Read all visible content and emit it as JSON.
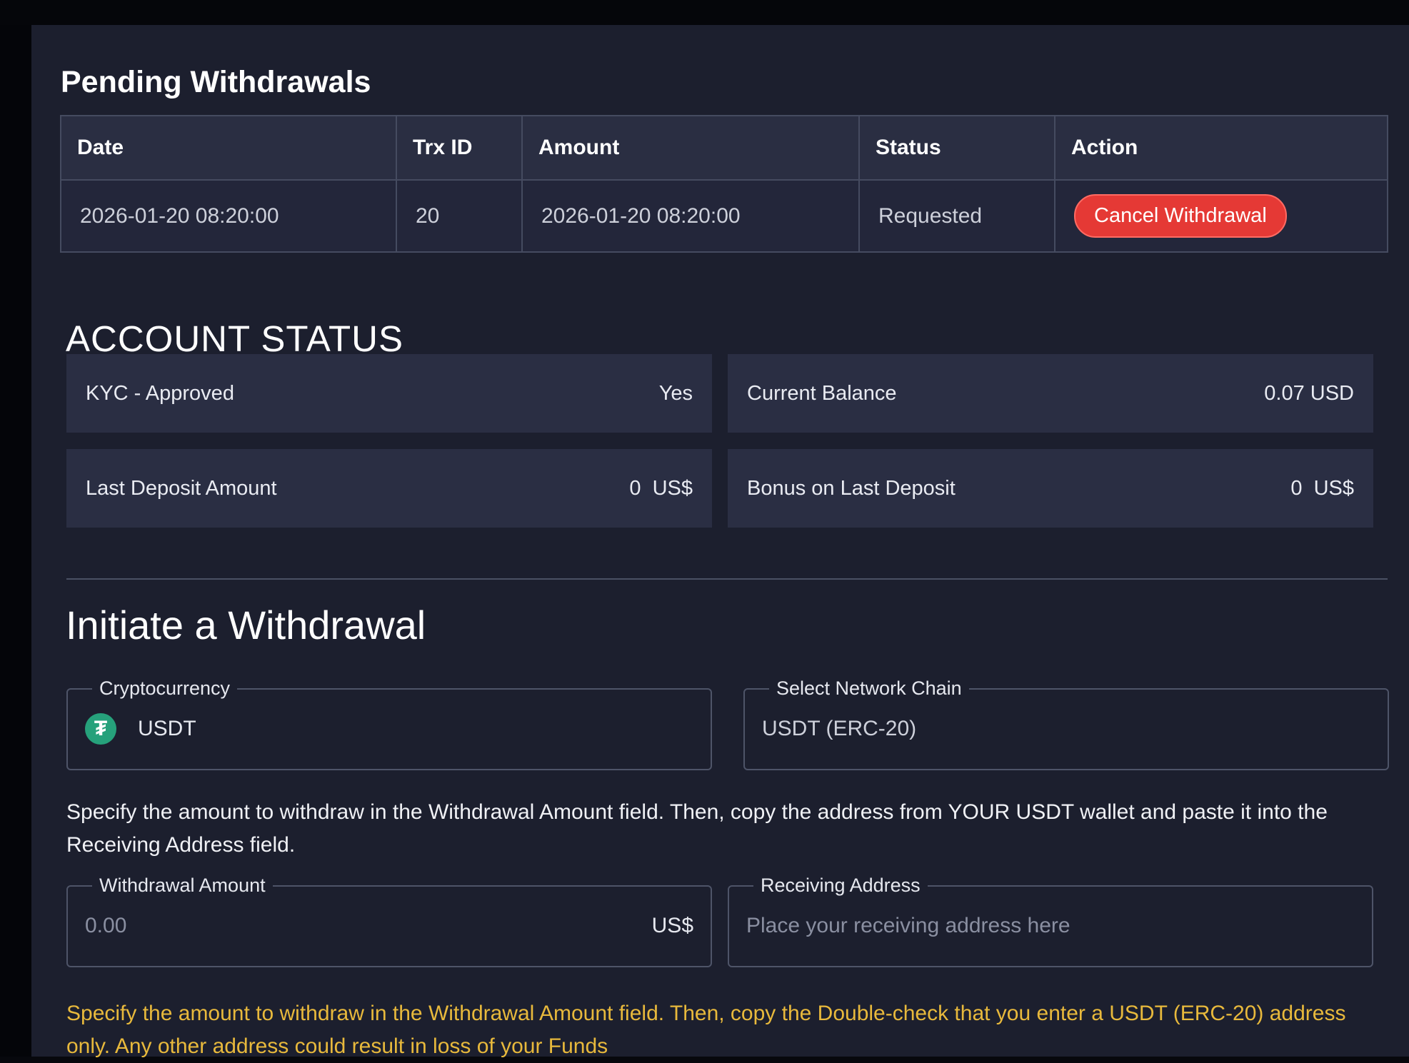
{
  "pending": {
    "title": "Pending Withdrawals",
    "columns": [
      "Date",
      "Trx ID",
      "Amount",
      "Status",
      "Action"
    ],
    "rows": [
      {
        "date": "2026-01-20 08:20:00",
        "trx_id": "20",
        "amount": "2026-01-20 08:20:00",
        "status": "Requested",
        "action": "Cancel Withdrawal"
      }
    ]
  },
  "account": {
    "title": "ACCOUNT STATUS",
    "kyc_label": "KYC - Approved",
    "kyc_value": "Yes",
    "balance_label": "Current Balance",
    "balance_value": "0.07 USD",
    "last_deposit_label": "Last Deposit Amount",
    "last_deposit_value": "0  US$",
    "bonus_label": "Bonus on Last Deposit",
    "bonus_value": "0  US$"
  },
  "withdraw": {
    "title": "Initiate a Withdrawal",
    "crypto_legend": "Cryptocurrency",
    "crypto_value": "USDT",
    "crypto_icon": "tether-icon",
    "network_legend": "Select Network Chain",
    "network_value": "USDT (ERC-20)",
    "instructions": "Specify the amount to withdraw in the Withdrawal Amount field. Then, copy the address from YOUR USDT wallet and paste it into the Receiving Address field.",
    "amount_legend": "Withdrawal Amount",
    "amount_placeholder": "0.00",
    "amount_unit": "US$",
    "address_legend": "Receiving Address",
    "address_placeholder": "Place your receiving address here",
    "warning": "Specify the amount to withdraw in the Withdrawal Amount field. Then, copy the Double-check that you enter a USDT (ERC-20) address only. Any other address could result in loss of your Funds"
  },
  "colors": {
    "panel": "#1c1f2e",
    "card": "#2a2e43",
    "danger": "#e53935",
    "warning_text": "#e8b93c",
    "tether": "#26a17b"
  }
}
